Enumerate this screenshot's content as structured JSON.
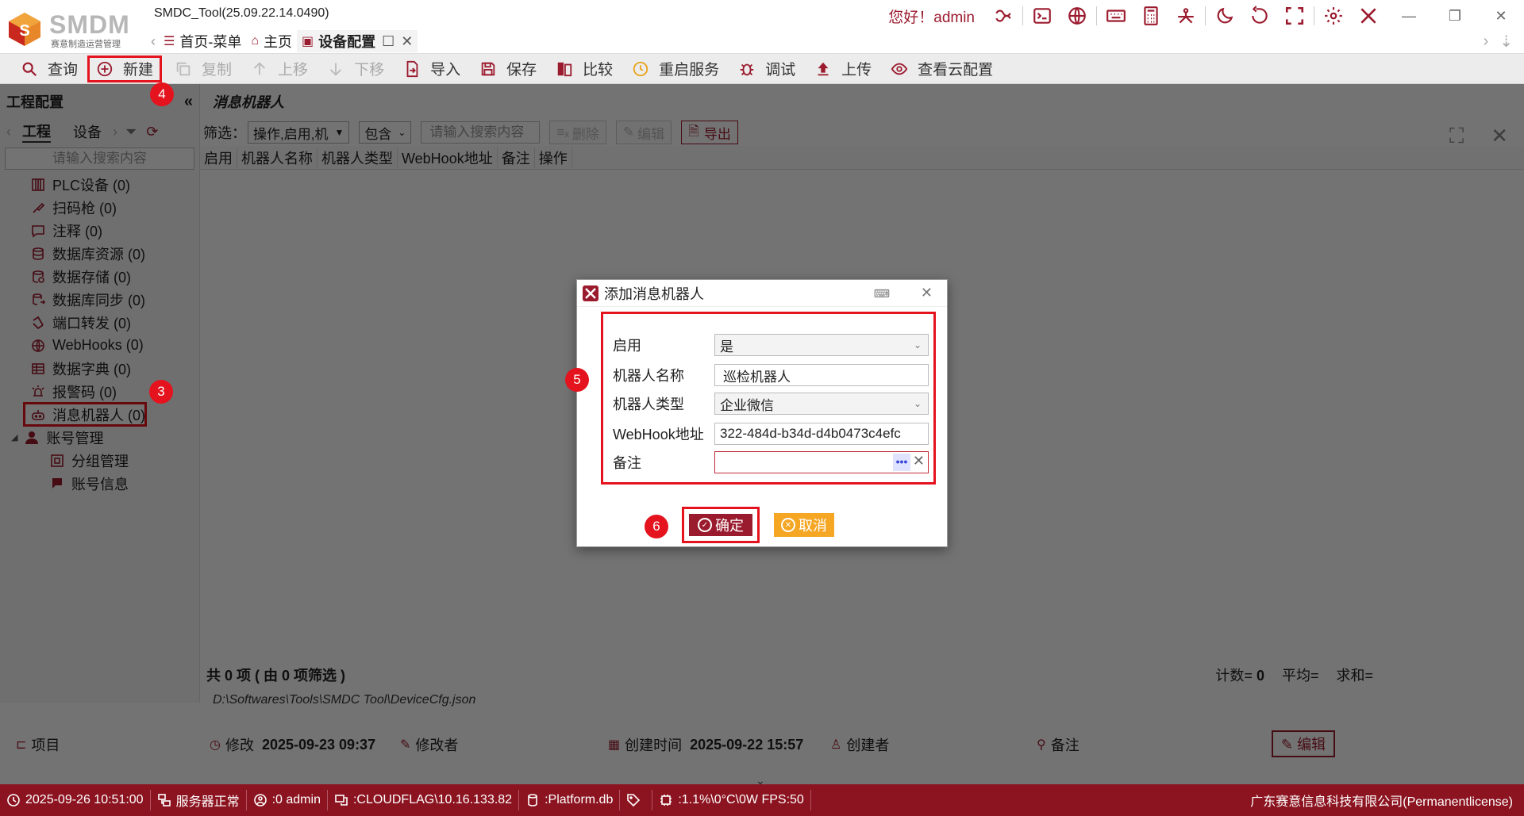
{
  "app": {
    "logo_text": "SMDM",
    "logo_subtitle": "赛意制造运营管理",
    "window_title": "SMDC_Tool(25.09.22.14.0490)",
    "greeting": "您好！admin"
  },
  "tabs": [
    {
      "label": "首页-菜单",
      "icon": "menu-icon"
    },
    {
      "label": "主页",
      "icon": "home-icon"
    },
    {
      "label": "设备配置",
      "icon": "config-icon",
      "active": true
    }
  ],
  "toolbar": {
    "query": "查询",
    "new": "新建",
    "copy": "复制",
    "move_up": "上移",
    "move_down": "下移",
    "import": "导入",
    "save": "保存",
    "compare": "比较",
    "restart": "重启服务",
    "debug": "调试",
    "upload": "上传",
    "view_cloud": "查看云配置"
  },
  "left_panel": {
    "title": "工程配置",
    "tab_project": "工程",
    "tab_device": "设备",
    "search_placeholder": "请输入搜索内容",
    "items": [
      {
        "label": "PLC设备 (0)",
        "icon": "plc-icon"
      },
      {
        "label": "扫码枪 (0)",
        "icon": "scanner-icon"
      },
      {
        "label": "注释 (0)",
        "icon": "comment-icon"
      },
      {
        "label": "数据库资源 (0)",
        "icon": "database-icon"
      },
      {
        "label": "数据存储 (0)",
        "icon": "storage-icon"
      },
      {
        "label": "数据库同步 (0)",
        "icon": "sync-icon"
      },
      {
        "label": "端口转发 (0)",
        "icon": "port-icon"
      },
      {
        "label": "WebHooks (0)",
        "icon": "globe-icon"
      },
      {
        "label": "数据字典 (0)",
        "icon": "table-icon"
      },
      {
        "label": "报警码 (0)",
        "icon": "alarm-icon"
      },
      {
        "label": "消息机器人 (0)",
        "icon": "robot-icon"
      }
    ],
    "account": {
      "label": "账号管理",
      "children": [
        "分组管理",
        "账号信息"
      ]
    }
  },
  "main": {
    "title": "消息机器人",
    "filter_label": "筛选：",
    "filter_field": "操作,启用,机",
    "filter_op": "包含",
    "filter_placeholder": "请输入搜索内容",
    "delete": "删除",
    "edit": "编辑",
    "export": "导出",
    "columns": [
      "启用",
      "机器人名称",
      "机器人类型",
      "WebHook地址",
      "备注",
      "操作"
    ],
    "summary": "共 0 项 ( 由 0 项筛选 )",
    "count_label": "计数=",
    "count_value": "0",
    "avg_label": "平均=",
    "sum_label": "求和=",
    "file_path": "D:\\Softwares\\Tools\\SMDC Tool\\DeviceCfg.json"
  },
  "info_bar": {
    "project": "项目",
    "modified_label": "修改",
    "modified_time": "2025-09-23 09:37",
    "modifier_label": "修改者",
    "created_label": "创建时间",
    "created_time": "2025-09-22 15:57",
    "creator_label": "创建者",
    "remark_label": "备注",
    "edit": "编辑"
  },
  "status_bar": {
    "datetime": "2025-09-26 10:51:00",
    "server": "服务器正常",
    "user": ":0 admin",
    "host": ":CLOUDFLAG\\10.16.133.82",
    "db": ":Platform.db",
    "perf": ":1.1%\\0°C\\0W  FPS:50",
    "company": "广东赛意信息科技有限公司(Permanentlicense)"
  },
  "dialog": {
    "title": "添加消息机器人",
    "enable_label": "启用",
    "enable_value": "是",
    "name_label": "机器人名称",
    "name_value": "巡检机器人",
    "type_label": "机器人类型",
    "type_value": "企业微信",
    "webhook_label": "WebHook地址",
    "webhook_value": "322-484d-b34d-d4b0473c4efc",
    "remark_label": "备注",
    "remark_value": "",
    "ok": "确定",
    "cancel": "取消"
  },
  "badges": [
    "3",
    "4",
    "5",
    "6"
  ],
  "colors": {
    "accent": "#9b1b2e",
    "status_bg": "#8c1420",
    "highlight": "#e4131e",
    "cancel": "#f5a623"
  }
}
